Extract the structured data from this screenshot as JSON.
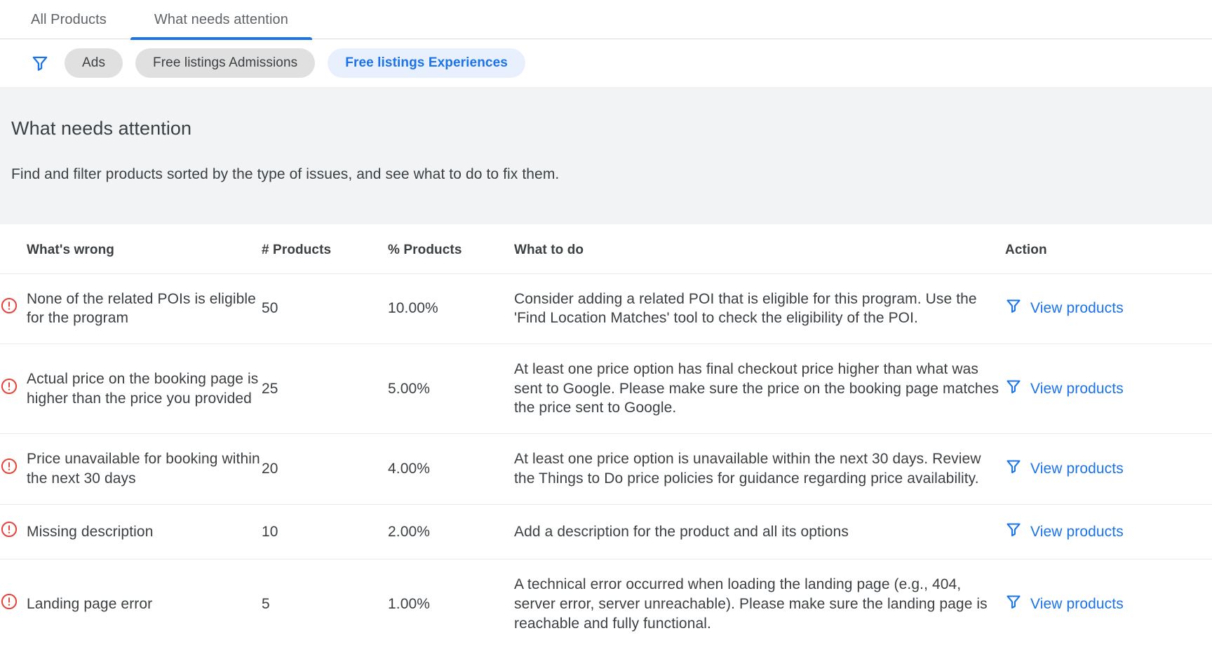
{
  "colors": {
    "accent": "#1a73e8",
    "chip_selected_bg": "#e8f0fe",
    "chip_bg": "#e0e0e0",
    "banner_bg": "#f1f3f4",
    "error_red": "#e8453c",
    "text": "#3c4043",
    "divider": "#e8eaed"
  },
  "tabs": [
    {
      "label": "All Products",
      "active": false
    },
    {
      "label": "What needs attention",
      "active": true
    }
  ],
  "filters": {
    "icon": "filter-icon",
    "chips": [
      {
        "label": "Ads",
        "selected": false
      },
      {
        "label": "Free listings Admissions",
        "selected": false
      },
      {
        "label": "Free listings Experiences",
        "selected": true
      }
    ]
  },
  "banner": {
    "title": "What needs attention",
    "subtitle": "Find and filter products sorted by the type of issues, and see what to do to fix them."
  },
  "table": {
    "columns": [
      "What's wrong",
      "# Products",
      "% Products",
      "What to do",
      "Action"
    ],
    "action_label": "View products",
    "action_icon": "filter-icon",
    "row_icon": "error-circle-icon",
    "rows": [
      {
        "whats_wrong": "None of the related POIs is eligible for the program",
        "num_products": "50",
        "pct_products": "10.00%",
        "what_to_do": "Consider adding a related POI that is eligible for this program. Use the 'Find Location Matches' tool to check the eligibility of the POI.",
        "action": "View products"
      },
      {
        "whats_wrong": "Actual price on the booking page is higher than the price you provided",
        "num_products": "25",
        "pct_products": "5.00%",
        "what_to_do": "At least one price option has final checkout price higher than what was sent to Google. Please make sure the price on the booking page matches the price sent to Google.",
        "action": "View products"
      },
      {
        "whats_wrong": "Price unavailable for booking within the next 30 days",
        "num_products": "20",
        "pct_products": "4.00%",
        "what_to_do": "At least one price option is unavailable within the next 30 days. Review the Things to Do price policies for guidance regarding price availability.",
        "action": "View products"
      },
      {
        "whats_wrong": "Missing description",
        "num_products": "10",
        "pct_products": "2.00%",
        "what_to_do": "Add a description for the product and all its options",
        "action": "View products"
      },
      {
        "whats_wrong": "Landing page error",
        "num_products": "5",
        "pct_products": "1.00%",
        "what_to_do": "A technical error occurred when loading the landing page (e.g., 404, server error, server unreachable). Please make sure the landing page is reachable and fully functional.",
        "action": "View products"
      }
    ]
  }
}
